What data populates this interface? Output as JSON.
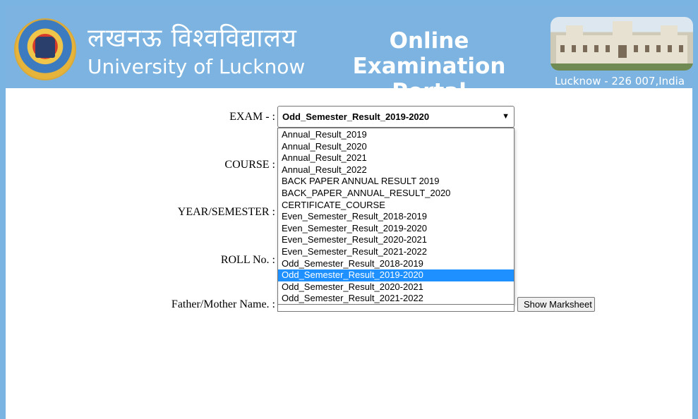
{
  "header": {
    "hindi_name": "लखनऊ विश्वविद्यालय",
    "university_name": "University of Lucknow",
    "portal_title_line1": "Online Examination",
    "portal_title_line2": "Portal",
    "location": "Lucknow - 226 007,India"
  },
  "form": {
    "exam_label": "EXAM - :",
    "course_label": "COURSE :",
    "year_semester_label": "YEAR/SEMESTER :",
    "roll_label": "ROLL No. :",
    "parent_name_label": "Father/Mother Name. :",
    "exam_selected": "Odd_Semester_Result_2019-2020",
    "exam_options": [
      "Annual_Result_2019",
      "Annual_Result_2020",
      "Annual_Result_2021",
      "Annual_Result_2022",
      "BACK PAPER ANNUAL RESULT 2019",
      "BACK_PAPER_ANNUAL_RESULT_2020",
      "CERTIFICATE_COURSE",
      "Even_Semester_Result_2018-2019",
      "Even_Semester_Result_2019-2020",
      "Even_Semester_Result_2020-2021",
      "Even_Semester_Result_2021-2022",
      "Odd_Semester_Result_2018-2019",
      "Odd_Semester_Result_2019-2020",
      "Odd_Semester_Result_2020-2021",
      "Odd_Semester_Result_2021-2022"
    ],
    "selected_index": 12,
    "show_button_label": "Show Marksheet"
  },
  "icons": {
    "dropdown": "chevron-down-icon",
    "seal": "university-seal-logo"
  },
  "colors": {
    "header_bg": "#7cb3e1",
    "selection": "#1e90ff"
  }
}
